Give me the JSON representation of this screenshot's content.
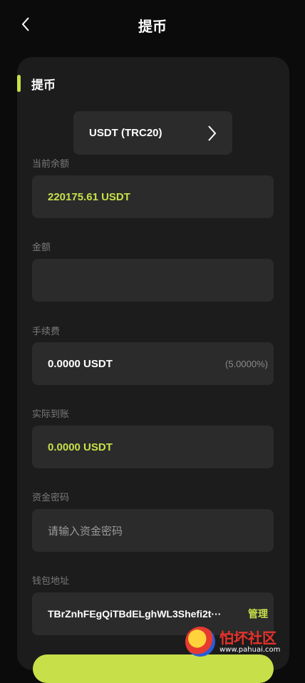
{
  "header": {
    "title": "提币"
  },
  "section": {
    "title": "提币"
  },
  "coin": {
    "selected": "USDT (TRC20)"
  },
  "balance": {
    "label": "当前余额",
    "value": "220175.61 USDT"
  },
  "amount": {
    "label": "金额",
    "value": "",
    "placeholder": ""
  },
  "fee": {
    "label": "手续费",
    "value": "0.0000 USDT",
    "rate": "(5.0000%)"
  },
  "actual": {
    "label": "实际到账",
    "value": "0.0000 USDT"
  },
  "fund_password": {
    "label": "资金密码",
    "placeholder": "请输入资金密码"
  },
  "wallet": {
    "label": "钱包地址",
    "address": "TBrZnhFEgQiTBdELghWL3Shefi2t···",
    "manage_label": "管理"
  },
  "watermark": {
    "name": "怕坏社区",
    "url": "www.pahuai.com"
  },
  "colors": {
    "accent": "#c7e04a",
    "card": "#1c1c1c",
    "field": "#2b2b2b",
    "background": "#0b0b0b"
  }
}
